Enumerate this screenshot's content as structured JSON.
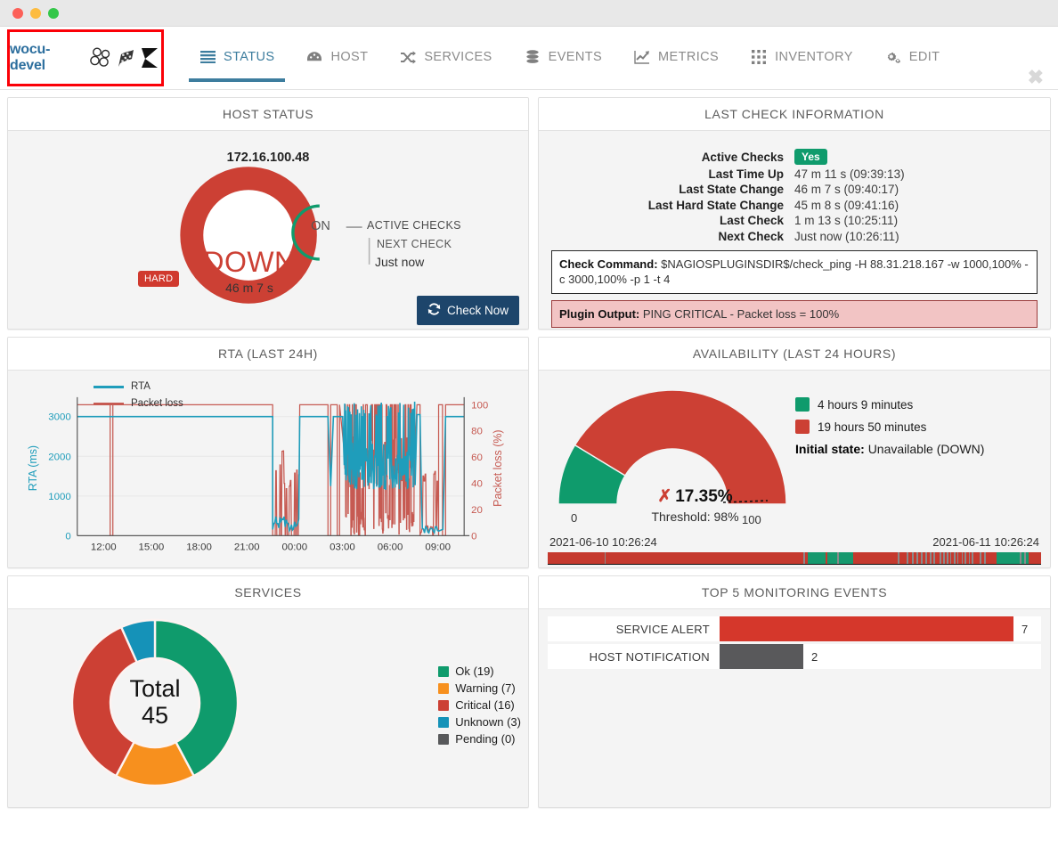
{
  "window": {
    "buttons": [
      "close",
      "minimize",
      "maximize"
    ]
  },
  "brand": {
    "name": "wocu-devel",
    "icons": [
      "cluster-icon",
      "flag-icon",
      "k-logo-icon"
    ]
  },
  "nav": {
    "tabs": [
      {
        "label": "STATUS",
        "icon": "list-icon",
        "active": true
      },
      {
        "label": "HOST",
        "icon": "gauge-icon",
        "active": false
      },
      {
        "label": "SERVICES",
        "icon": "shuffle-icon",
        "active": false
      },
      {
        "label": "EVENTS",
        "icon": "database-icon",
        "active": false
      },
      {
        "label": "METRICS",
        "icon": "line-chart-icon",
        "active": false
      },
      {
        "label": "INVENTORY",
        "icon": "grid-icon",
        "active": false
      },
      {
        "label": "EDIT",
        "icon": "gears-icon",
        "active": false
      }
    ],
    "close_label": "✖"
  },
  "host_status": {
    "title": "HOST STATUS",
    "ip": "172.16.100.48",
    "state": "DOWN",
    "duration": "46 m 7 s",
    "hard_badge": "HARD",
    "active_checks_toggle": "ON",
    "active_checks_label": "ACTIVE CHECKS",
    "next_check_label": "NEXT CHECK",
    "next_check_value": "Just now",
    "check_now_label": "Check Now",
    "colors": {
      "down": "#cc4034",
      "on": "#0f9b6c",
      "button": "#1d456b"
    }
  },
  "last_check": {
    "title": "LAST CHECK INFORMATION",
    "rows": [
      {
        "key": "Active Checks",
        "value": "Yes",
        "type": "badge"
      },
      {
        "key": "Last Time Up",
        "value": "47 m 11 s (09:39:13)",
        "type": "text"
      },
      {
        "key": "Last State Change",
        "value": "46 m 7 s (09:40:17)",
        "type": "text"
      },
      {
        "key": "Last Hard State Change",
        "value": "45 m 8 s (09:41:16)",
        "type": "text"
      },
      {
        "key": "Last Check",
        "value": "1 m 13 s (10:25:11)",
        "type": "text"
      },
      {
        "key": "Next Check",
        "value": "Just now (10:26:11)",
        "type": "dim"
      }
    ],
    "check_command_label": "Check Command:",
    "check_command_value": "$NAGIOSPLUGINSDIR$/check_ping -H 88.31.218.167 -w 1000,100% -c 3000,100% -p 1 -t 4",
    "plugin_output_label": "Plugin Output:",
    "plugin_output_value": "PING CRITICAL - Packet loss = 100%"
  },
  "rta": {
    "title": "RTA (LAST 24H)"
  },
  "availability": {
    "title": "AVAILABILITY (LAST 24 HOURS)",
    "percent": "17.35%",
    "threshold_label": "Threshold: 98%",
    "gauge_min": "0",
    "gauge_max": "100",
    "legend": [
      {
        "label": "4 hours 9 minutes",
        "color": "#0f9b6c"
      },
      {
        "label": "19 hours 50 minutes",
        "color": "#cc4034"
      }
    ],
    "initial_state_label": "Initial state:",
    "initial_state_value": "Unavailable (DOWN)",
    "date_start": "2021-06-10 10:26:24",
    "date_end": "2021-06-11 10:26:24"
  },
  "services": {
    "title": "SERVICES",
    "total_label": "Total",
    "total_value": "45"
  },
  "events": {
    "title": "TOP 5 MONITORING EVENTS"
  },
  "chart_data": [
    {
      "type": "line",
      "title": "RTA (LAST 24H)",
      "xlabel": "",
      "ylabel": "RTA (ms)",
      "y2label": "Packet loss (%)",
      "xticks": [
        "12:00",
        "15:00",
        "18:00",
        "21:00",
        "00:00",
        "03:00",
        "06:00",
        "09:00"
      ],
      "yticks": [
        0,
        1000,
        2000,
        3000
      ],
      "ylim": [
        0,
        3400
      ],
      "y2ticks": [
        0,
        20,
        40,
        60,
        80,
        100
      ],
      "y2lim": [
        0,
        103
      ],
      "grid": true,
      "legend": [
        {
          "name": "RTA",
          "color": "#1f9dbb"
        },
        {
          "name": "Packet loss",
          "color": "#c65a52"
        }
      ],
      "series": [
        {
          "name": "RTA",
          "color": "#1f9dbb",
          "axis": "left",
          "note": "flat at 3000 ms for most of window; drops to 0-500 between 23:10-00:30 and again in the 03:00-09:00 noisy region; returns to 3000 after 09:15"
        },
        {
          "name": "Packet loss",
          "color": "#c65a52",
          "axis": "right",
          "note": "flat at 100% for most of window with one drop spike near 13:00; 0-100 oscillation 23:10-00:30 and heavy oscillation 03:00-08:00"
        }
      ]
    },
    {
      "type": "pie",
      "title": "SERVICES",
      "total": 45,
      "labels": [
        "Ok (19)",
        "Warning (7)",
        "Critical (16)",
        "Unknown (3)",
        "Pending (0)"
      ],
      "categories": [
        "Ok",
        "Warning",
        "Critical",
        "Unknown",
        "Pending"
      ],
      "values": [
        19,
        7,
        16,
        3,
        0
      ],
      "colors": [
        "#0f9b6c",
        "#f7901e",
        "#cc4034",
        "#1592b8",
        "#58595b"
      ],
      "legend_position": "right",
      "donut": true
    },
    {
      "type": "gauge",
      "title": "AVAILABILITY (LAST 24 HOURS)",
      "value": 17.35,
      "threshold": 98,
      "min": 0,
      "max": 100,
      "segments": [
        {
          "label": "4 hours 9 minutes",
          "value": 17.35,
          "color": "#0f9b6c"
        },
        {
          "label": "19 hours 50 minutes",
          "value": 82.65,
          "color": "#cc4034"
        }
      ]
    },
    {
      "type": "bar",
      "title": "TOP 5 MONITORING EVENTS",
      "orientation": "horizontal",
      "categories": [
        "SERVICE ALERT",
        "HOST NOTIFICATION"
      ],
      "values": [
        7,
        2
      ],
      "colors": [
        "#d5372b",
        "#59595b"
      ],
      "xlim": [
        0,
        7
      ]
    }
  ]
}
